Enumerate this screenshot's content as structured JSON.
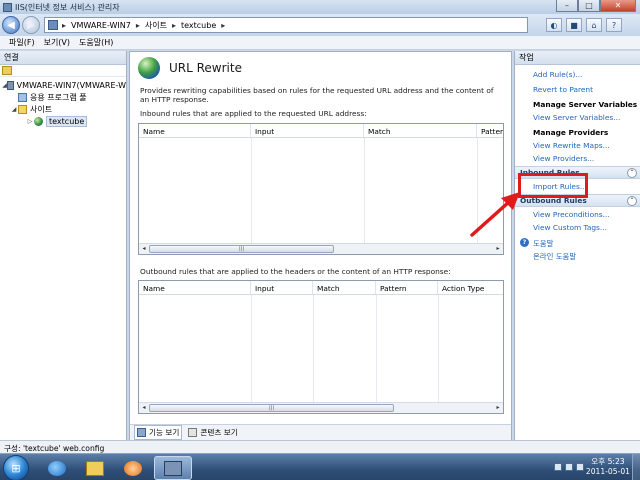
{
  "window": {
    "title": "IIS(인터넷 정보 서비스) 관리자",
    "controls": {
      "minimize": "–",
      "maximize": "□",
      "close": "✕"
    }
  },
  "address": {
    "segments": [
      "VMWARE-WIN7",
      "사이트",
      "textcube"
    ],
    "separator": "▸"
  },
  "menu": [
    "파일(F)",
    "보기(V)",
    "도움말(H)"
  ],
  "left_pane": {
    "title": "연결",
    "tree": [
      {
        "label": "VMWARE-WIN7(VMWARE-W",
        "icon": "server-icon",
        "expander": "◢"
      },
      {
        "label": "응용 프로그램 풀",
        "icon": "app-pool-icon",
        "expander": ""
      },
      {
        "label": "사이트",
        "icon": "folder-icon",
        "expander": "◢"
      },
      {
        "label": "textcube",
        "icon": "globe-icon",
        "expander": "▷"
      }
    ]
  },
  "main": {
    "title": "URL Rewrite",
    "description": "Provides rewriting capabilities based on rules for the requested URL address and the content of an HTTP response.",
    "inbound_label": "Inbound rules that are applied to the requested URL address:",
    "inbound_columns": [
      "Name",
      "Input",
      "Match",
      "Pattern"
    ],
    "outbound_label": "Outbound rules that are applied to the headers or the content of an HTTP response:",
    "outbound_columns": [
      "Name",
      "Input",
      "Match",
      "Pattern",
      "Action Type"
    ],
    "scroll_left": "◂",
    "scroll_right": "▸",
    "scroll_grip": "|||",
    "tabs": [
      {
        "label": "기능 보기",
        "active": true
      },
      {
        "label": "콘텐츠 보기",
        "active": false
      }
    ]
  },
  "actions": {
    "title": "작업",
    "items": {
      "add_rules": "Add Rule(s)...",
      "revert": "Revert to Parent",
      "manage_server_variables": "Manage Server Variables",
      "view_server_variables": "View Server Variables...",
      "manage_providers": "Manage Providers",
      "view_rewrite_maps": "View Rewrite Maps...",
      "view_providers": "View Providers...",
      "inbound_rules": "Inbound Rules",
      "import_rules": "Import Rules...",
      "outbound_rules": "Outbound Rules",
      "view_preconditions": "View Preconditions...",
      "view_custom_tags": "View Custom Tags...",
      "help": "도움말",
      "online_help": "온라인 도움말"
    },
    "collapse_glyph": "⌃",
    "help_glyph": "?"
  },
  "status": "구성: 'textcube' web.config",
  "taskbar": {
    "start_glyph": "⊞",
    "clock_time": "오후 5:23",
    "clock_date": "2011-05-01"
  },
  "colors": {
    "annotation": "#e01b1b",
    "link": "#2166bb"
  }
}
